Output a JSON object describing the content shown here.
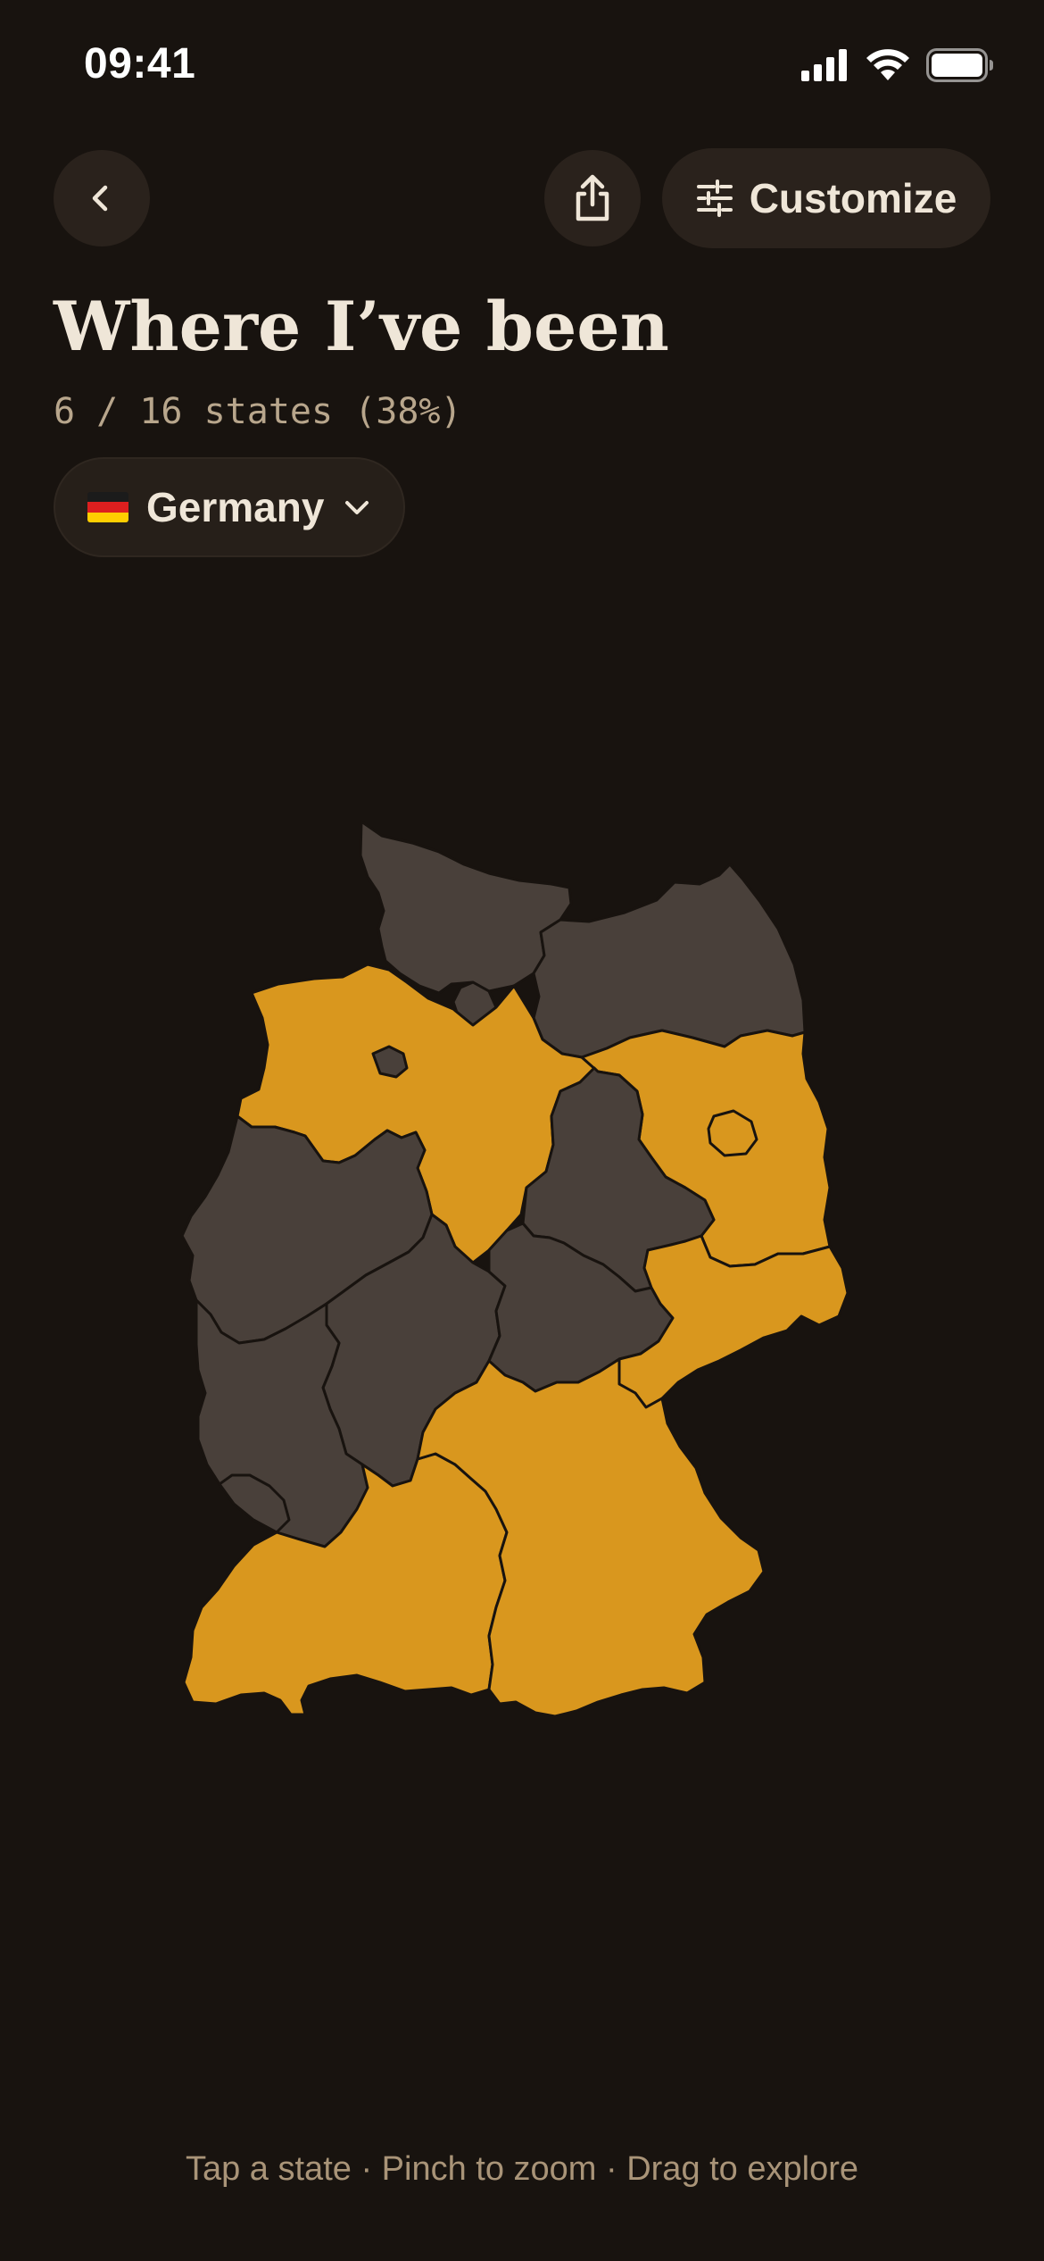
{
  "status_bar": {
    "time": "09:41"
  },
  "header": {
    "customize_label": "Customize"
  },
  "title": "Where I’ve been",
  "progress": {
    "text": "6 / 16 states (38%)",
    "visited": 6,
    "total": 16
  },
  "country_select": {
    "label": "Germany"
  },
  "map": {
    "colors": {
      "visited": "#d9971e",
      "unvisited": "#49403a",
      "border": "#18130f"
    },
    "states": [
      {
        "id": "SH",
        "visited": false
      },
      {
        "id": "MV",
        "visited": false
      },
      {
        "id": "HH",
        "visited": false
      },
      {
        "id": "HB",
        "visited": false
      },
      {
        "id": "NI",
        "visited": true
      },
      {
        "id": "BB",
        "visited": true
      },
      {
        "id": "BE",
        "visited": true
      },
      {
        "id": "ST",
        "visited": false
      },
      {
        "id": "NW",
        "visited": false
      },
      {
        "id": "HE",
        "visited": false
      },
      {
        "id": "TH",
        "visited": false
      },
      {
        "id": "SN",
        "visited": true
      },
      {
        "id": "RP",
        "visited": false
      },
      {
        "id": "SL",
        "visited": false
      },
      {
        "id": "BW",
        "visited": true
      },
      {
        "id": "BY",
        "visited": true
      }
    ]
  },
  "hint": "Tap a state · Pinch to zoom · Drag to explore",
  "colors": {
    "background": "#18130f",
    "button": "#2a221c",
    "text": "#efe6d8",
    "muted": "#b8a68c",
    "accent": "#d9971e"
  }
}
